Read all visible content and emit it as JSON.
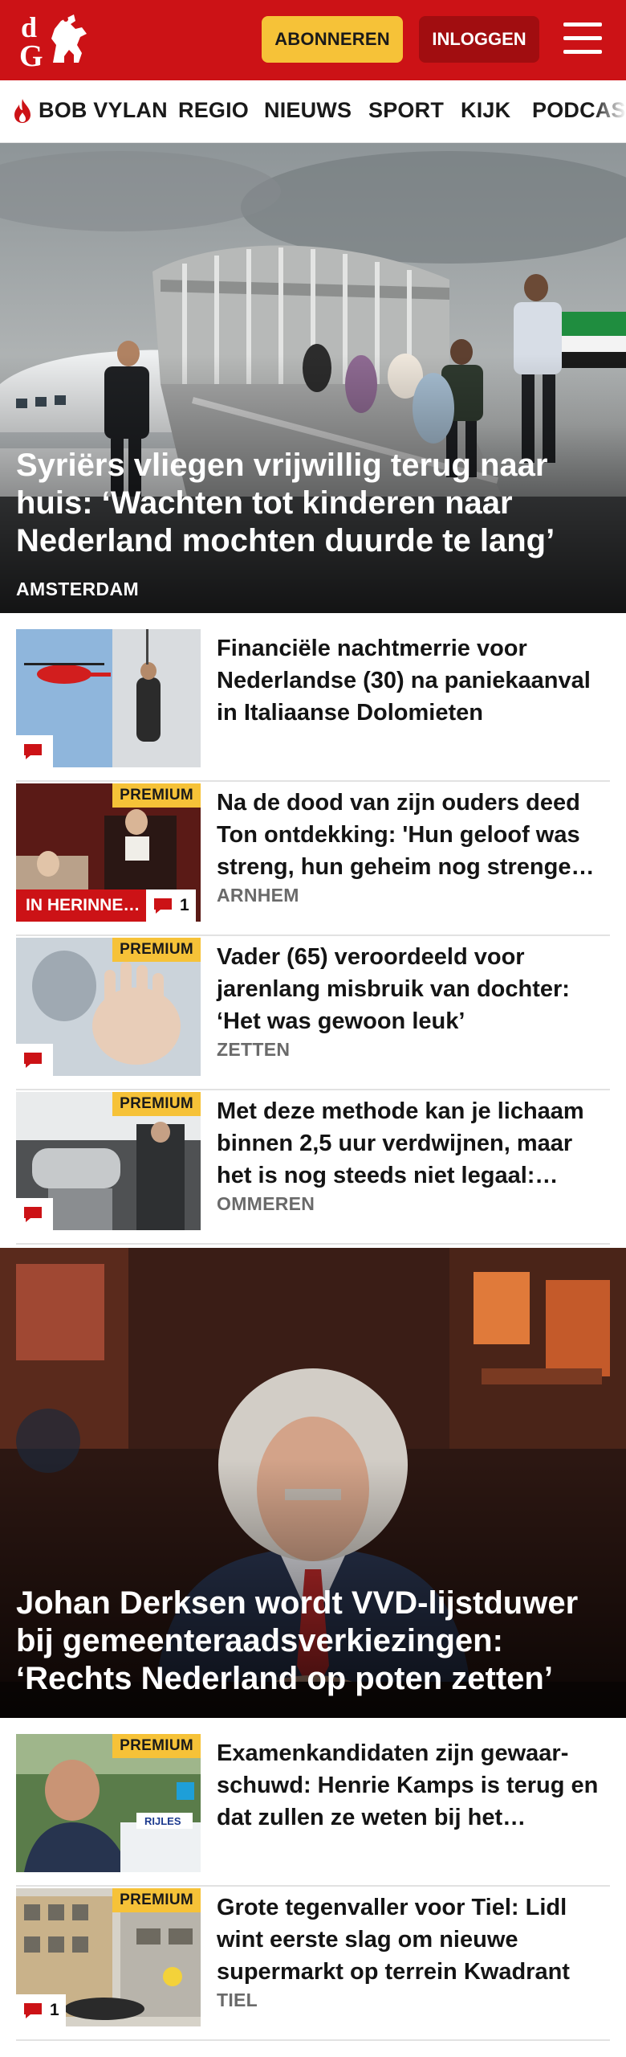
{
  "header": {
    "logo_text": "dG",
    "subscribe_label": "ABONNEREN",
    "login_label": "INLOGGEN",
    "menu_icon": "hamburger-icon",
    "brand_color": "#cc1216",
    "accent_color": "#f6c238"
  },
  "nav": {
    "items": [
      "BOB VYLAN",
      "REGIO",
      "NIEUWS",
      "SPORT",
      "KIJK",
      "PODCAST"
    ],
    "trending_icon": "flame-icon"
  },
  "hero1": {
    "title": "Syriërs vliegen vrijwillig terug naar huis: ‘Wachten tot kinderen naar Nederland mochten duurde te lang’",
    "location": "AMSTERDAM"
  },
  "articles1": [
    {
      "title": "Financiële nachtmerrie voor Nederlandse (30) na paniekaan­val in Italiaanse Dolomieten",
      "location": "",
      "premium": "",
      "comments": "",
      "label": ""
    },
    {
      "title": "Na de dood van zijn ouders deed Ton ontdekking: 'Hun geloof was streng, hun geheim nog strenge…",
      "location": "ARNHEM",
      "premium": "PREMIUM",
      "comments": "1",
      "label": "IN HERINNE…"
    },
    {
      "title": "Vader (65) veroordeeld voor jarenlang misbruik van dochter: ‘Het was gewoon leuk’",
      "location": "ZETTEN",
      "premium": "PREMIUM",
      "comments": "",
      "label": ""
    },
    {
      "title": "Met deze methode kan je lichaam binnen 2,5 uur verdwijnen, maar het is nog steeds niet legaal:…",
      "location": "OMMEREN",
      "premium": "PREMIUM",
      "comments": "",
      "label": ""
    }
  ],
  "hero2": {
    "title": "Johan Derksen wordt VVD-lijstduwer bij gemeenteraadsverkiezingen: ‘Rechts Nederland op poten zetten’",
    "location": ""
  },
  "articles2": [
    {
      "title": "Examenkandidaten zijn gewaar­schuwd: Henrie Kamps is terug en dat zullen ze weten bij het…",
      "location": "",
      "premium": "PREMIUM",
      "comments": "",
      "label": ""
    },
    {
      "title": "Grote tegenvaller voor Tiel: Lidl wint eerste slag om nieuwe supermarkt op terrein Kwadrant",
      "location": "TIEL",
      "premium": "PREMIUM",
      "comments": "1",
      "label": ""
    }
  ]
}
